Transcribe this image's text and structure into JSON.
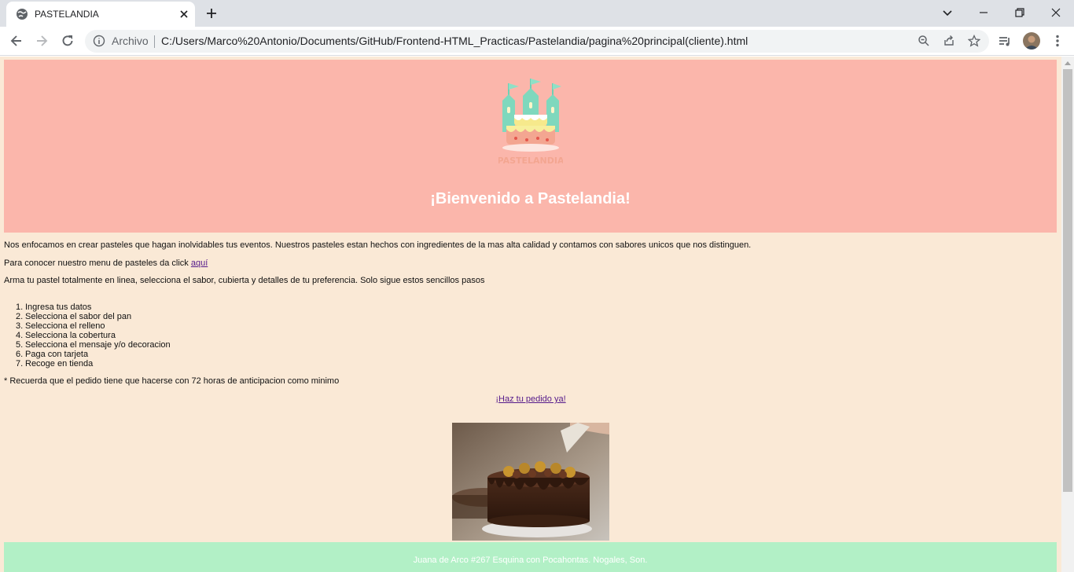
{
  "browser": {
    "tab_title": "PASTELANDIA",
    "omnibox_security_label": "Archivo",
    "url": "C:/Users/Marco%20Antonio/Documents/GitHub/Frontend-HTML_Practicas/Pastelandia/pagina%20principal(cliente).html"
  },
  "hero": {
    "logo_text": "PASTELANDIA",
    "title": "¡Bienvenido a Pastelandia!"
  },
  "content": {
    "intro": "Nos enfocamos en crear pasteles que hagan inolvidables tus eventos. Nuestros pasteles estan hechos con ingredientes de la mas alta calidad y contamos con sabores unicos que nos distinguen.",
    "menu_prefix": "Para conocer nuestro menu de pasteles da click ",
    "menu_link": "aquí",
    "build_intro": "Arma tu pastel totalmente en linea, selecciona el sabor, cubierta y detalles de tu preferencia. Solo sigue estos sencillos pasos",
    "steps": [
      "Ingresa tus datos",
      "Selecciona el sabor del pan",
      "Selecciona el relleno",
      "Selecciona la cobertura",
      "Selecciona el mensaje y/o decoracion",
      "Paga con tarjeta",
      "Recoge en tienda"
    ],
    "note": "* Recuerda que el pedido tiene que hacerse con 72 horas de anticipacion como minimo",
    "order_link": "¡Haz tu pedido ya!"
  },
  "footer": {
    "address": "Juana de Arco #267 Esquina con Pocahontas. Nogales, Son."
  },
  "colors": {
    "page_bg": "#fae9d6",
    "hero_bg": "#fbb6ab",
    "footer_bg": "#b2f0c6",
    "link": "#551a8b"
  }
}
